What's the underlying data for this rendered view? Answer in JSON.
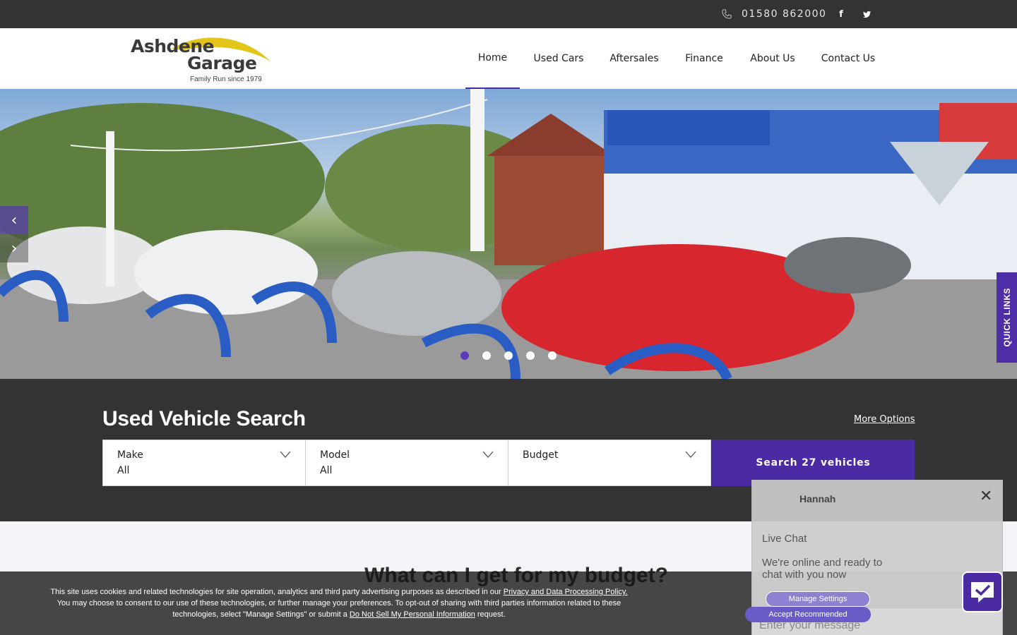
{
  "topbar": {
    "phone": "01580 862000",
    "social": [
      "facebook-icon",
      "twitter-icon"
    ]
  },
  "brand": {
    "line1": "Ashdene",
    "line2": "Garage",
    "tagline": "Family Run since 1979",
    "accent": "#e3c51a"
  },
  "nav": {
    "items": [
      {
        "label": "Home",
        "active": true
      },
      {
        "label": "Used Cars"
      },
      {
        "label": "Aftersales"
      },
      {
        "label": "Finance"
      },
      {
        "label": "About Us"
      },
      {
        "label": "Contact Us"
      }
    ]
  },
  "hero": {
    "slide_count": 5,
    "active_slide": 1,
    "quick_links": "QUICK LINKS"
  },
  "search": {
    "title": "Used Vehicle Search",
    "more_options": "More Options",
    "make_label": "Make",
    "make_value": "All",
    "model_label": "Model",
    "model_value": "All",
    "budget_label": "Budget",
    "search_button": "Search 27 vehicles"
  },
  "lower": {
    "heading": "What can I get for my budget?"
  },
  "cookie": {
    "text1": "This site uses cookies and related technologies for site operation, analytics and third party advertising purposes as described in our ",
    "link1": "Privacy and Data Processing Policy.",
    "text2": " You may choose to consent to our use of these technologies, or further manage your preferences. To opt-out of sharing with third parties information related to these technologies, select \"Manage Settings\" or submit a ",
    "link2": "Do Not Sell My Personal Information",
    "text3": " request.",
    "manage": "Manage Settings",
    "accept": "Accept Recommended"
  },
  "chat": {
    "agent": "Hannah",
    "title": "Live Chat",
    "message": "We're online and ready to chat with you now",
    "placeholder": "Enter your message"
  },
  "colors": {
    "brand_purple": "#4a2ba3",
    "dark_bar": "#333333"
  }
}
